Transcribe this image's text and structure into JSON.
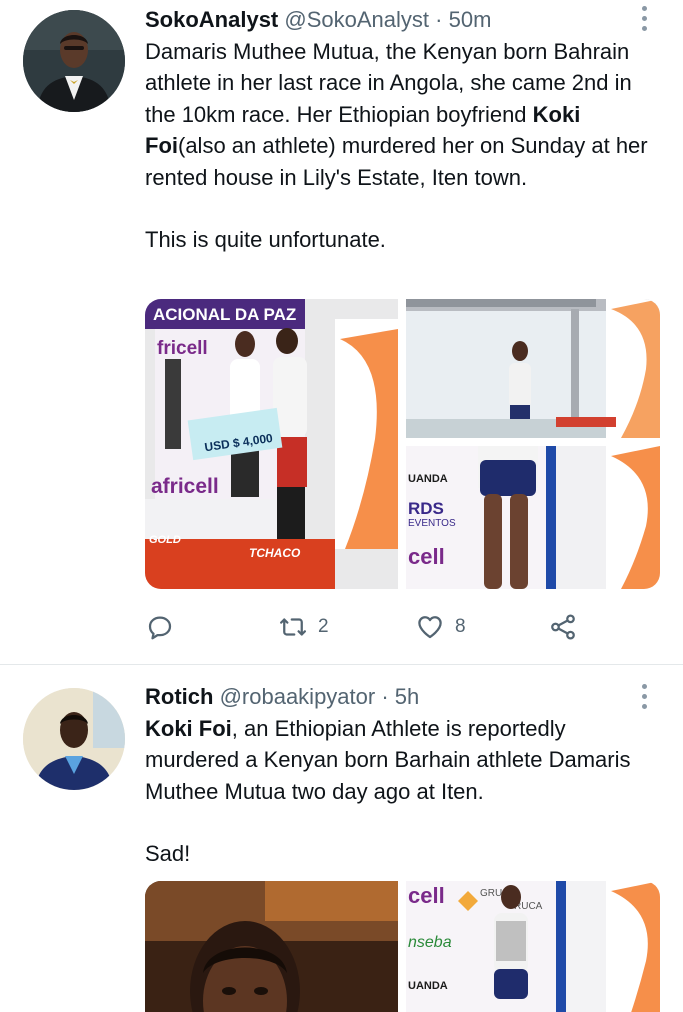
{
  "tweets": [
    {
      "name": "SokoAnalyst",
      "handle": "@SokoAnalyst",
      "separator": "·",
      "time": "50m",
      "text_parts": {
        "p1_before": "Damaris Muthee Mutua, the Kenyan born Bahrain athlete in her last race in Angola, she came 2nd in the 10km race. Her Ethiopian boyfriend ",
        "p1_bold": "Koki Foi",
        "p1_after": "(also an athlete) murdered her on Sunday at her rented house in Lily's Estate, Iten town.",
        "p2": "This is quite unfortunate."
      },
      "media": {
        "photo1": {
          "banner": "ACIONAL DA PAZ",
          "brand1": "fricell",
          "cheque": "USD $ 4,000",
          "brand2": "africell",
          "brand3": "TCHACO",
          "ad1": "GOLD"
        },
        "photo2": {},
        "photo3": {
          "ad1": "UANDA",
          "ad2": "RDS",
          "ad3": "EVENTOS",
          "ad4": "cell"
        }
      },
      "actions": {
        "reply_count": "",
        "retweet_count": "2",
        "like_count": "8"
      }
    },
    {
      "name": "Rotich",
      "handle": "@robaakipyator",
      "separator": "·",
      "time": "5h",
      "text_parts": {
        "p1_bold": "Koki Foi",
        "p1_after": ", an Ethiopian Athlete is reportedly murdered a Kenyan born Barhain athlete Damaris Muthee Mutua two day ago at Iten.",
        "p2": "Sad!"
      },
      "media": {
        "photo2": {
          "ad1": "cell",
          "ad2": "GRU",
          "ad3": "RUCA",
          "ad4": "nseba",
          "ad5": "UANDA"
        }
      }
    }
  ],
  "colors": {
    "text": "#0f1419",
    "secondary": "#536471",
    "icon": "#536471",
    "divider": "#e4e8ea"
  },
  "icons": {
    "reply": "comment-bubble-icon",
    "retweet": "retweet-arrows-icon",
    "like": "heart-icon",
    "share": "share-icon",
    "more": "vertical-dots-icon"
  }
}
